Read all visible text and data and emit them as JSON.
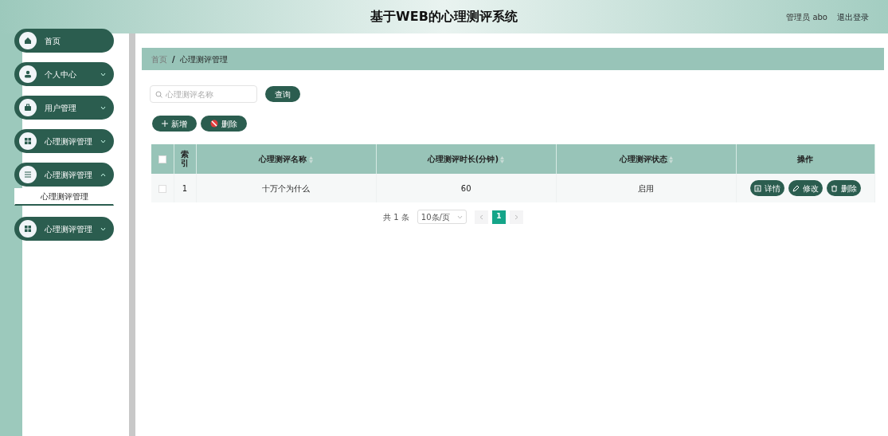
{
  "header": {
    "title": "基于WEB的心理测评系统",
    "user": "管理员 abo",
    "logout": "退出登录"
  },
  "sidebar": {
    "items": [
      {
        "label": "首页",
        "has_children": false
      },
      {
        "label": "个人中心",
        "has_children": true,
        "expanded": false
      },
      {
        "label": "用户管理",
        "has_children": true,
        "expanded": false
      },
      {
        "label": "心理测评管理",
        "has_children": true,
        "expanded": false
      },
      {
        "label": "心理测评管理",
        "has_children": true,
        "expanded": true,
        "children": [
          {
            "label": "心理测评管理",
            "selected": true
          }
        ]
      },
      {
        "label": "心理测评管理",
        "has_children": true,
        "expanded": false
      }
    ]
  },
  "breadcrumb": {
    "separator": "/",
    "items": [
      "首页",
      "心理测评管理"
    ]
  },
  "search": {
    "placeholder": "心理测评名称",
    "button": "查询"
  },
  "toolbar": [
    {
      "kind": "add",
      "label": "新增"
    },
    {
      "kind": "delete",
      "label": "删除"
    }
  ],
  "table": {
    "all_checked": false,
    "columns": [
      {
        "label": "索引",
        "sortable": false
      },
      {
        "label": "心理测评名称",
        "sortable": true
      },
      {
        "label": "心理测评时长(分钟)",
        "sortable": true
      },
      {
        "label": "心理测评状态",
        "sortable": true
      },
      {
        "label": "操作",
        "sortable": false
      }
    ],
    "rows": [
      {
        "checked": false,
        "cells": [
          "1",
          "十万个为什么",
          "60",
          "启用"
        ],
        "actions": [
          {
            "kind": "detail",
            "label": "详情"
          },
          {
            "kind": "edit",
            "label": "修改"
          },
          {
            "kind": "delete",
            "label": "删除"
          }
        ]
      }
    ]
  },
  "pagination": {
    "total": "共 1 条",
    "page_size": "10条/页",
    "pages": [
      {
        "label": "1",
        "selected": true
      }
    ]
  }
}
